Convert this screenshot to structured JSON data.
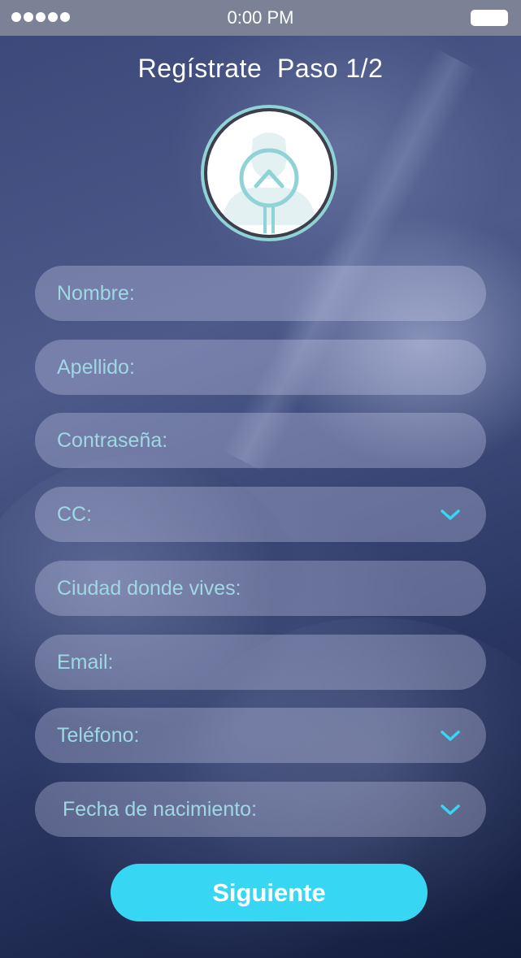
{
  "status_bar": {
    "time": "0:00 PM",
    "signal_icon": "signal-dots-icon",
    "battery_icon": "battery-icon"
  },
  "header": {
    "title": "Regístrate  Paso 1/2"
  },
  "avatar": {
    "icon": "user-avatar-upload-icon",
    "accent_color": "#8fd3d6"
  },
  "form": {
    "fields": [
      {
        "label": "Nombre:",
        "has_dropdown": false
      },
      {
        "label": "Apellido:",
        "has_dropdown": false
      },
      {
        "label": "Contraseña:",
        "has_dropdown": false
      },
      {
        "label": "CC:",
        "has_dropdown": true
      },
      {
        "label": "Ciudad donde vives:",
        "has_dropdown": false
      },
      {
        "label": "Email:",
        "has_dropdown": false
      },
      {
        "label": "Teléfono:",
        "has_dropdown": true
      },
      {
        "label": "Fecha de nacimiento:",
        "has_dropdown": true
      }
    ],
    "dropdown_icon": "chevron-down-icon",
    "label_color": "#9fd8e3"
  },
  "actions": {
    "next_label": "Siguiente",
    "next_color": "#37d7f4"
  }
}
